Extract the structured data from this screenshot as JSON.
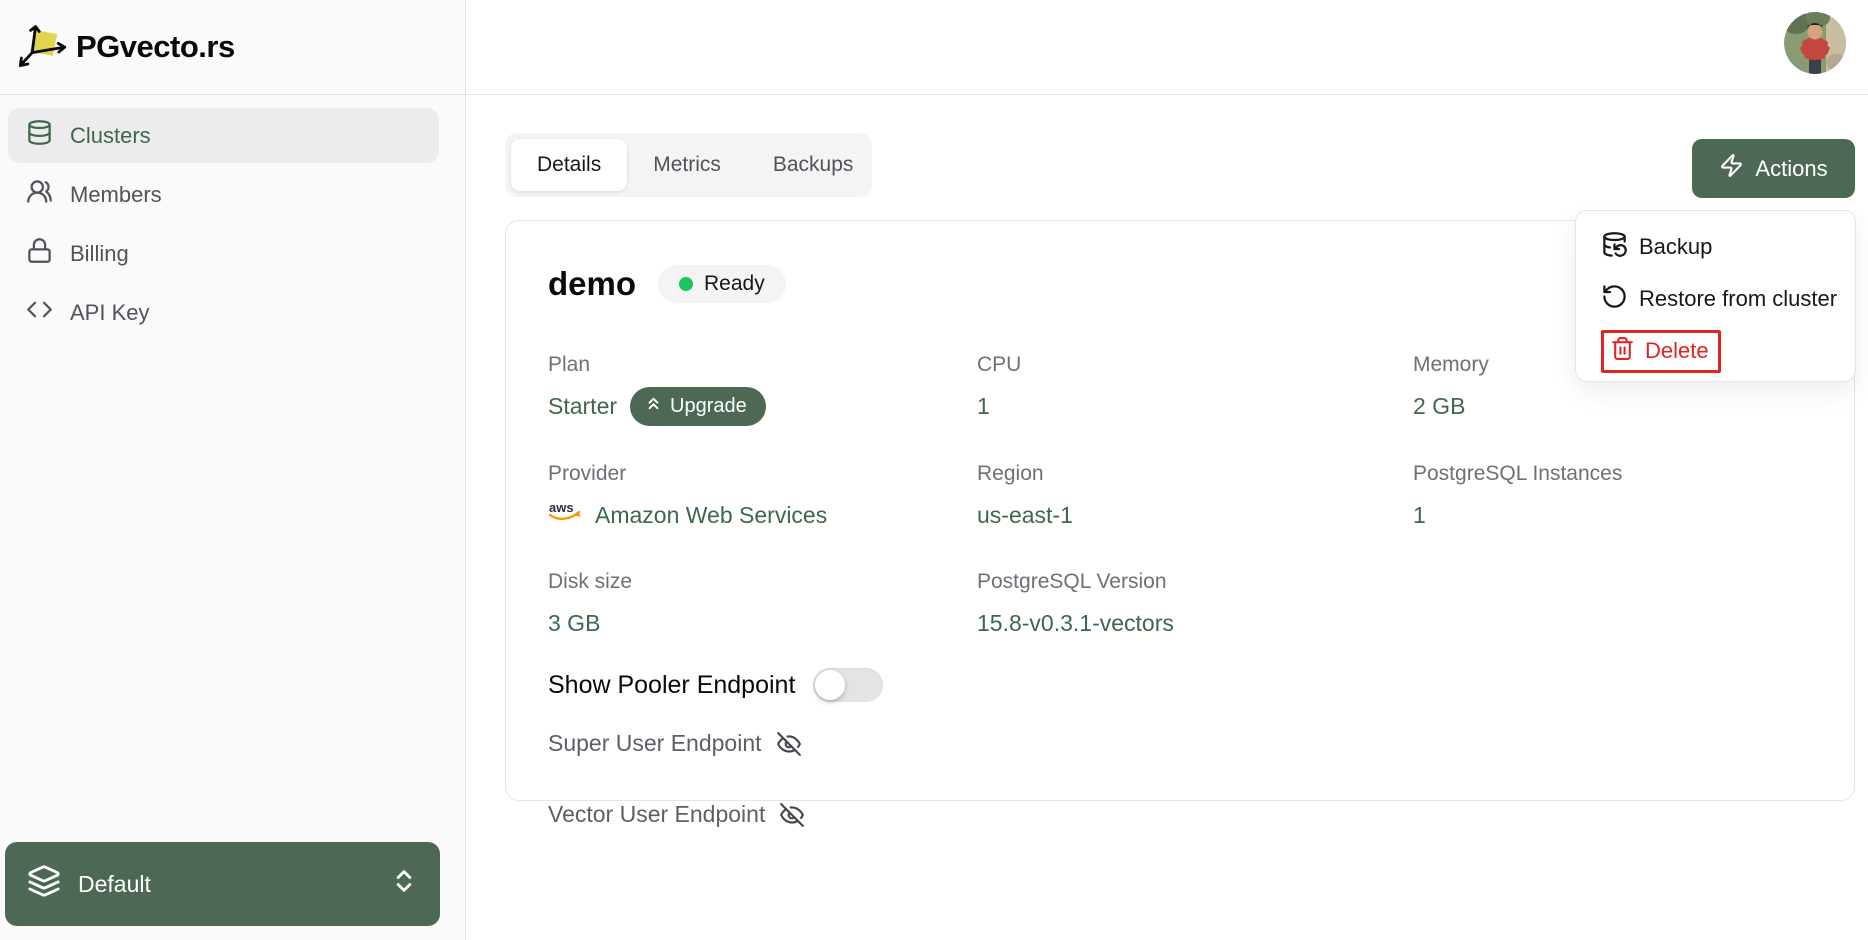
{
  "app": {
    "name": "PGvecto.rs"
  },
  "sidebar": {
    "items": [
      {
        "label": "Clusters",
        "icon": "database-icon",
        "active": true
      },
      {
        "label": "Members",
        "icon": "users-icon",
        "active": false
      },
      {
        "label": "Billing",
        "icon": "lock-icon",
        "active": false
      },
      {
        "label": "API Key",
        "icon": "code-icon",
        "active": false
      }
    ],
    "org_switcher": {
      "label": "Default",
      "icon": "layers-icon"
    }
  },
  "tabs": [
    {
      "label": "Details",
      "active": true
    },
    {
      "label": "Metrics",
      "active": false
    },
    {
      "label": "Backups",
      "active": false
    }
  ],
  "actions": {
    "button_label": "Actions",
    "icon": "zap-icon",
    "menu": [
      {
        "label": "Backup",
        "icon": "database-backup-icon",
        "danger": false
      },
      {
        "label": "Restore from cluster",
        "icon": "rotate-ccw-icon",
        "danger": false
      },
      {
        "label": "Delete",
        "icon": "trash-icon",
        "danger": true,
        "highlighted": true
      }
    ]
  },
  "cluster": {
    "name": "demo",
    "status": "Ready",
    "upgrade_label": "Upgrade",
    "fields": [
      {
        "label": "Plan",
        "value": "Starter",
        "has_upgrade": true
      },
      {
        "label": "CPU",
        "value": "1"
      },
      {
        "label": "Memory",
        "value": "2 GB"
      },
      {
        "label": "Provider",
        "value": "Amazon Web Services",
        "icon": "aws-logo-icon"
      },
      {
        "label": "Region",
        "value": "us-east-1"
      },
      {
        "label": "PostgreSQL Instances",
        "value": "1"
      },
      {
        "label": "Disk size",
        "value": "3 GB"
      },
      {
        "label": "PostgreSQL Version",
        "value": "15.8-v0.3.1-vectors"
      }
    ],
    "pooler_toggle": {
      "label": "Show Pooler Endpoint",
      "on": false
    },
    "endpoints": [
      {
        "label": "Super User Endpoint",
        "icon": "eye-off-icon"
      },
      {
        "label": "Vector User Endpoint",
        "icon": "eye-off-icon"
      }
    ]
  },
  "colors": {
    "primary_green": "#4d6854",
    "value_green": "#3f674b",
    "danger_red": "#e02424",
    "ready_dot": "#1cc45e",
    "sidebar_bg": "#fafafa",
    "border": "#e4e4e7"
  }
}
